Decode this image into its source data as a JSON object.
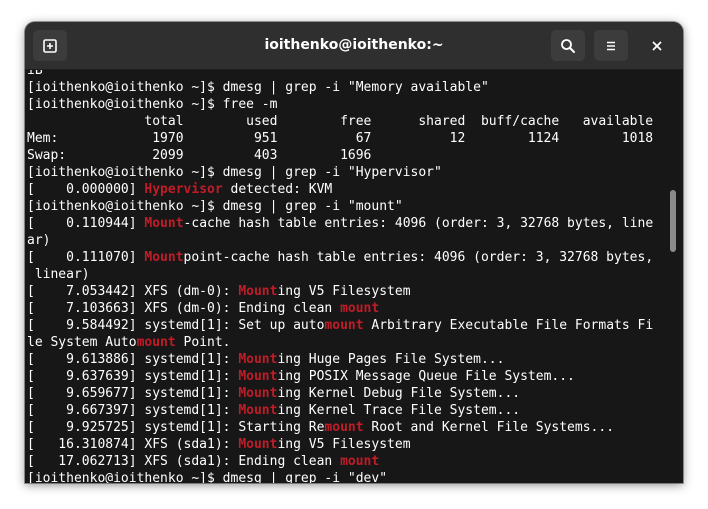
{
  "window": {
    "title": "ioithenko@ioithenko:~",
    "icons": {
      "new_tab": "new-tab-icon",
      "search": "search-icon",
      "menu": "hamburger-menu-icon",
      "close": "close-icon"
    },
    "colors": {
      "background": "#171717",
      "headerbar": "#2f2f2f",
      "text": "#ffffff",
      "highlight": "#c01c28"
    }
  },
  "terminal": {
    "lines": [
      [
        {
          "t": "iB"
        }
      ],
      [
        {
          "t": "[ioithenko@ioithenko ~]$ dmesg | grep -i \"Memory available\""
        }
      ],
      [
        {
          "t": "[ioithenko@ioithenko ~]$ free -m"
        }
      ],
      [
        {
          "t": "               total        used        free      shared  buff/cache   available"
        }
      ],
      [
        {
          "t": "Mem:            1970         951          67          12        1124        1018"
        }
      ],
      [
        {
          "t": "Swap:           2099         403        1696"
        }
      ],
      [
        {
          "t": "[ioithenko@ioithenko ~]$ dmesg | grep -i \"Hypervisor\""
        }
      ],
      [
        {
          "t": "[    0.000000] "
        },
        {
          "t": "Hypervisor",
          "h": true
        },
        {
          "t": " detected: KVM"
        }
      ],
      [
        {
          "t": "[ioithenko@ioithenko ~]$ dmesg | grep -i \"mount\""
        }
      ],
      [
        {
          "t": "[    0.110944] "
        },
        {
          "t": "Mount",
          "h": true
        },
        {
          "t": "-cache hash table entries: 4096 (order: 3, 32768 bytes, line"
        }
      ],
      [
        {
          "t": "ar)"
        }
      ],
      [
        {
          "t": "[    0.111070] "
        },
        {
          "t": "Mount",
          "h": true
        },
        {
          "t": "point-cache hash table entries: 4096 (order: 3, 32768 bytes,"
        }
      ],
      [
        {
          "t": " linear)"
        }
      ],
      [
        {
          "t": "[    7.053442] XFS (dm-0): "
        },
        {
          "t": "Mount",
          "h": true
        },
        {
          "t": "ing V5 Filesystem"
        }
      ],
      [
        {
          "t": "[    7.103663] XFS (dm-0): Ending clean "
        },
        {
          "t": "mount",
          "h": true
        }
      ],
      [
        {
          "t": "[    9.584492] systemd[1]: Set up auto"
        },
        {
          "t": "mount",
          "h": true
        },
        {
          "t": " Arbitrary Executable File Formats Fi"
        }
      ],
      [
        {
          "t": "le System Auto"
        },
        {
          "t": "mount",
          "h": true
        },
        {
          "t": " Point."
        }
      ],
      [
        {
          "t": "[    9.613886] systemd[1]: "
        },
        {
          "t": "Mount",
          "h": true
        },
        {
          "t": "ing Huge Pages File System..."
        }
      ],
      [
        {
          "t": "[    9.637639] systemd[1]: "
        },
        {
          "t": "Mount",
          "h": true
        },
        {
          "t": "ing POSIX Message Queue File System..."
        }
      ],
      [
        {
          "t": "[    9.659677] systemd[1]: "
        },
        {
          "t": "Mount",
          "h": true
        },
        {
          "t": "ing Kernel Debug File System..."
        }
      ],
      [
        {
          "t": "[    9.667397] systemd[1]: "
        },
        {
          "t": "Mount",
          "h": true
        },
        {
          "t": "ing Kernel Trace File System..."
        }
      ],
      [
        {
          "t": "[    9.925725] systemd[1]: Starting Re"
        },
        {
          "t": "mount",
          "h": true
        },
        {
          "t": " Root and Kernel File Systems..."
        }
      ],
      [
        {
          "t": "[   16.310874] XFS (sda1): "
        },
        {
          "t": "Mount",
          "h": true
        },
        {
          "t": "ing V5 Filesystem"
        }
      ],
      [
        {
          "t": "[   17.062713] XFS (sda1): Ending clean "
        },
        {
          "t": "mount",
          "h": true
        }
      ],
      [
        {
          "t": "[ioithenko@ioithenko ~]$ dmesg | grep -i \"dev\""
        }
      ]
    ]
  }
}
